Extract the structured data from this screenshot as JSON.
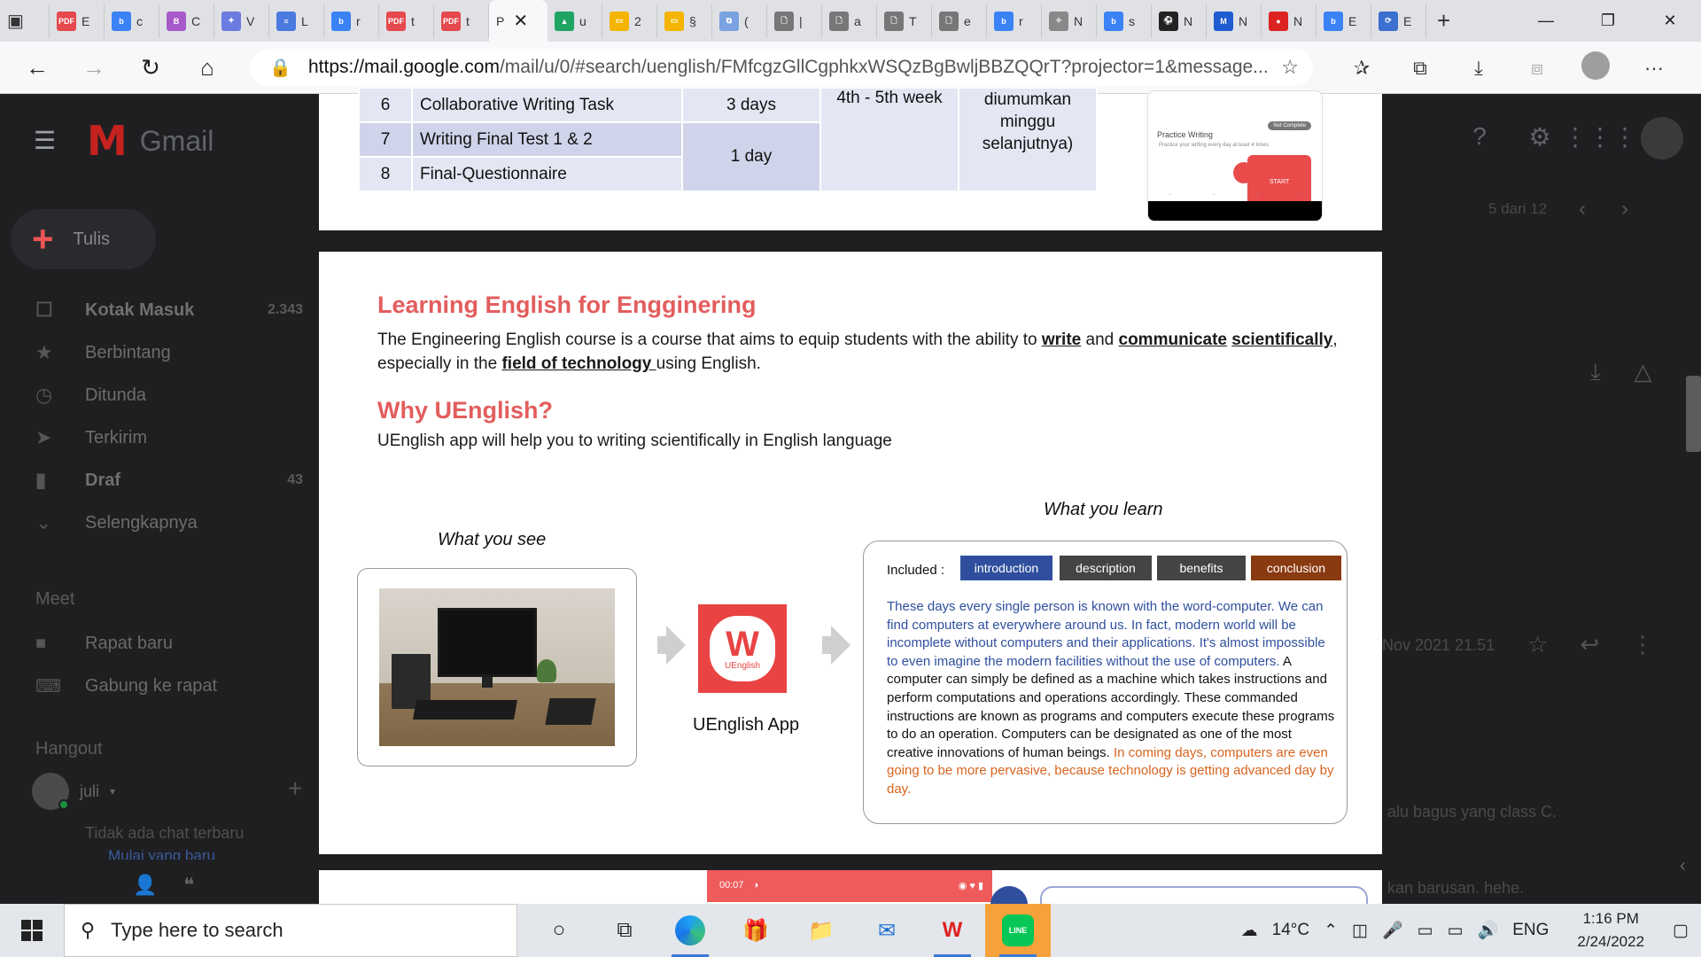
{
  "browser": {
    "tabs": [
      {
        "letter": "E",
        "fav": "PDF",
        "color": "#e5484d"
      },
      {
        "letter": "c",
        "fav": "b",
        "color": "#3b82f6"
      },
      {
        "letter": "C",
        "fav": "B",
        "color": "#a85acb"
      },
      {
        "letter": "V",
        "fav": "✦",
        "color": "#6b7be0"
      },
      {
        "letter": "L",
        "fav": "≡",
        "color": "#4a7ae0"
      },
      {
        "letter": "r",
        "fav": "b",
        "color": "#3b82f6"
      },
      {
        "letter": "t",
        "fav": "PDF",
        "color": "#e5484d"
      },
      {
        "letter": "t",
        "fav": "PDF",
        "color": "#e5484d"
      }
    ],
    "active_tab": {
      "letter": "P"
    },
    "tabs_right": [
      {
        "letter": "u",
        "fav": "▲",
        "color": "#1fa463"
      },
      {
        "letter": "2",
        "fav": "▭",
        "color": "#f4b400"
      },
      {
        "letter": "§",
        "fav": "▭",
        "color": "#f4b400"
      },
      {
        "letter": "(",
        "fav": "⧉",
        "color": "#7aa1e0"
      },
      {
        "letter": "|",
        "fav": "🗋",
        "color": "#777"
      },
      {
        "letter": "a",
        "fav": "🗋",
        "color": "#777"
      },
      {
        "letter": "T",
        "fav": "🗋",
        "color": "#777"
      },
      {
        "letter": "e",
        "fav": "🗋",
        "color": "#777"
      },
      {
        "letter": "r",
        "fav": "b",
        "color": "#3b82f6"
      },
      {
        "letter": "N",
        "fav": "✧",
        "color": "#888"
      },
      {
        "letter": "s",
        "fav": "b",
        "color": "#3b82f6"
      },
      {
        "letter": "N",
        "fav": "⚽",
        "color": "#222"
      },
      {
        "letter": "N",
        "fav": "M",
        "color": "#1f5bd1"
      },
      {
        "letter": "N",
        "fav": "●",
        "color": "#d22"
      },
      {
        "letter": "E",
        "fav": "b",
        "color": "#3b82f6"
      },
      {
        "letter": "E",
        "fav": "⟳",
        "color": "#3b6fd0"
      }
    ],
    "new_tab": "+",
    "url_host": "https://mail.google.com",
    "url_path": "/mail/u/0/#search/uenglish/FMfcgzGllCgphkxWSQzBgBwljBBZQQrT?projector=1&message..."
  },
  "gmail": {
    "logo_text": "Gmail",
    "compose": "Tulis",
    "nav": [
      {
        "label": "Kotak Masuk",
        "count": "2.343",
        "bold": true,
        "icon": "☐"
      },
      {
        "label": "Berbintang",
        "count": "",
        "bold": false,
        "icon": "★"
      },
      {
        "label": "Ditunda",
        "count": "",
        "bold": false,
        "icon": "◷"
      },
      {
        "label": "Terkirim",
        "count": "",
        "bold": false,
        "icon": "➤"
      },
      {
        "label": "Draf",
        "count": "43",
        "bold": true,
        "icon": "▮"
      },
      {
        "label": "Selengkapnya",
        "count": "",
        "bold": false,
        "icon": "⌄"
      }
    ],
    "meet_title": "Meet",
    "meet_new": "Rapat baru",
    "meet_join": "Gabung ke rapat",
    "hangout_title": "Hangout",
    "hangout_user": "juli",
    "no_chat": "Tidak ada chat terbaru",
    "start_new": "Mulai yang baru",
    "pager": "5 dari 12",
    "email_date": "Nov 2021 21.51",
    "snippet1": "alu bagus yang class C.",
    "snippet2": "kan barusan. hehe."
  },
  "doc": {
    "schedule": [
      {
        "no": "6",
        "task": "Collaborative Writing Task"
      },
      {
        "no": "7",
        "task": "Writing Final Test 1 & 2"
      },
      {
        "no": "8",
        "task": "Final-Questionnaire"
      }
    ],
    "dur_a": "3 days",
    "dur_b": "1 day",
    "week": "4th - 5th week",
    "ann_lines": [
      "diumumkan",
      "minggu",
      "selanjutnya)"
    ],
    "phone": {
      "title": "Practice Writing",
      "blurb": "Practice your writing every day at least 4 times",
      "complete": "Not Complete",
      "start": "START"
    },
    "h1": "Learning English for Engginering",
    "p1_a": "The Engineering English course is a course that aims to equip students with the ability to ",
    "p1_write": "write",
    "p1_and": " and ",
    "p1_comm": "communicate",
    "p1_sci": "scientifically",
    "p1_b": ", especially in the ",
    "p1_field": "field of technology ",
    "p1_c": "using English.",
    "h2": "Why UEnglish?",
    "p2": "UEnglish app will help you to writing scientifically in English language",
    "cap_see": "What you see",
    "cap_learn": "What you learn",
    "app_w": "W",
    "app_small": "UEnglish",
    "app_name": "UEnglish App",
    "included": "Included :",
    "tags": [
      "introduction",
      "description",
      "benefits",
      "conclusion"
    ],
    "essay_blue": "These days every single person is known with the word-computer. We can find computers at everywhere around us. In fact, modern world will be incomplete without computers and their applications. It's almost impossible to even imagine the modern facilities without the use of computers.",
    "essay_black": " A computer can simply be defined as a machine which takes instructions and perform computations and operations accordingly. These commanded instructions are known as programs and computers execute these programs to do an operation. Computers can be designated as one of the most creative innovations of human beings.",
    "essay_orange": " In coming days, computers are even going to be more pervasive, because technology is getting advanced day by day.",
    "rec_time": "00:07"
  },
  "taskbar": {
    "search_placeholder": "Type here to search",
    "weather": "14°C",
    "lang": "ENG",
    "time": "1:16 PM",
    "date": "2/24/2022",
    "line_label": "LINE"
  }
}
